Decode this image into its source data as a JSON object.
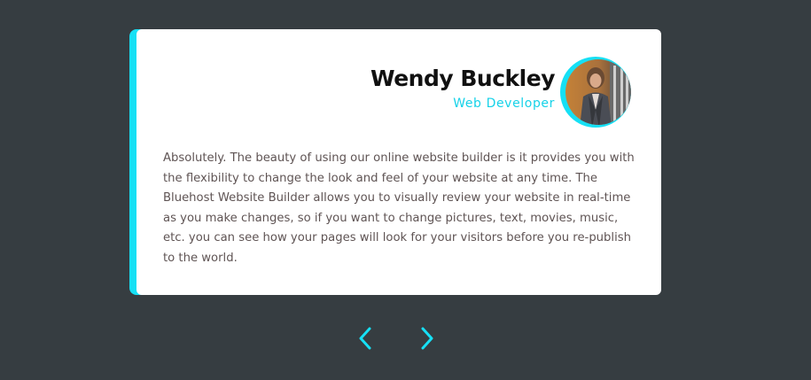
{
  "testimonial": {
    "author_name": "Wendy Buckley",
    "author_role": "Web Developer",
    "quote": "Absolutely. The beauty of using our online website builder is it provides you with the flexibility to change the look and feel of your website at any time. The Bluehost Website Builder allows you to visually review your website in real-time as you make changes, so if you want to change pictures, text, movies, music, etc. you can see how your pages will look for your visitors before you re-publish to the world."
  },
  "navigation": {
    "prev_icon": "chevron-left-icon",
    "next_icon": "chevron-right-icon"
  },
  "colors": {
    "background": "#363d41",
    "accent": "#16e0f5",
    "card": "#ffffff",
    "name_text": "#111111",
    "body_text": "#5f5454"
  }
}
